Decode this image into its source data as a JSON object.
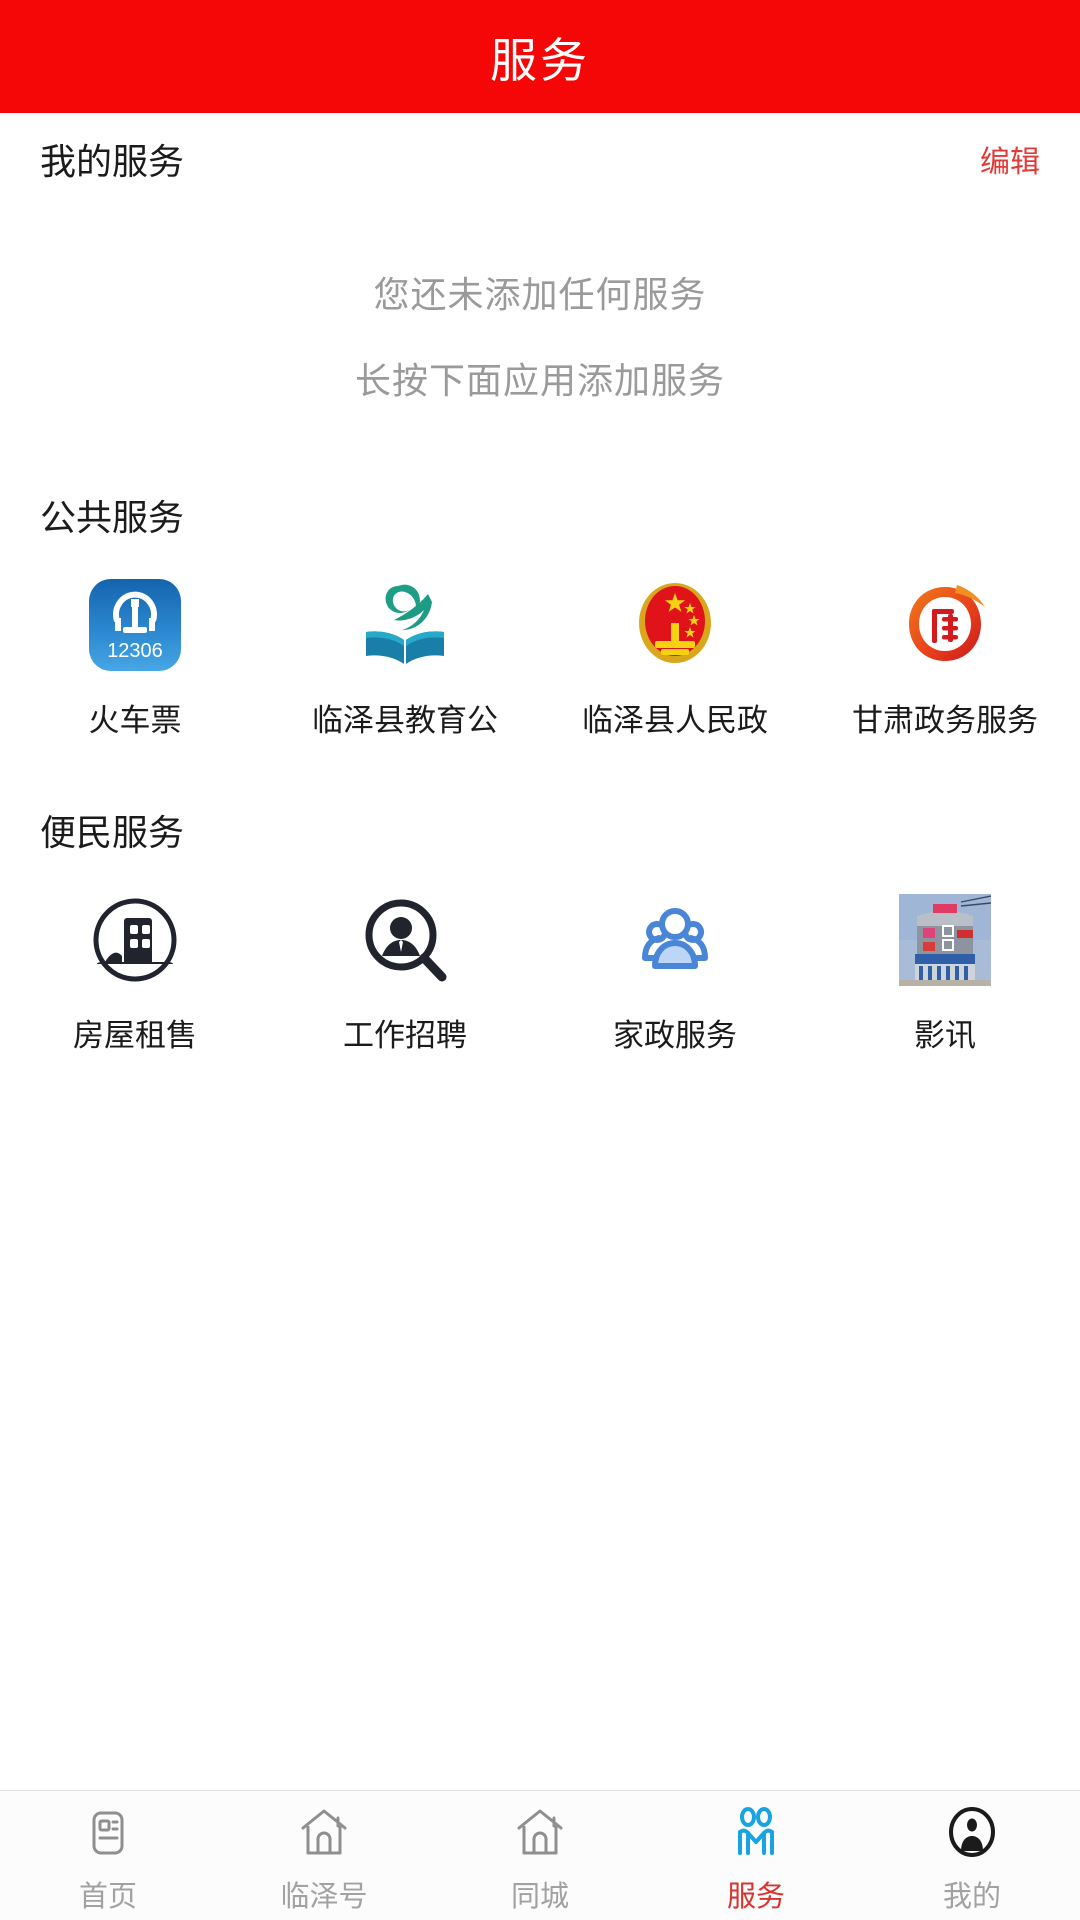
{
  "header": {
    "title": "服务",
    "bg_color": "#f50707"
  },
  "my_services": {
    "title": "我的服务",
    "edit_label": "编辑",
    "edit_color": "#e23a37",
    "empty_line_1": "您还未添加任何服务",
    "empty_line_2": "长按下面应用添加服务"
  },
  "sections": [
    {
      "title": "公共服务",
      "items": [
        {
          "label": "火车票",
          "icon": "railway-12306-icon",
          "badge_text": "12306"
        },
        {
          "label": "临泽县教育公",
          "icon": "education-book-icon"
        },
        {
          "label": "临泽县人民政",
          "icon": "national-emblem-icon"
        },
        {
          "label": "甘肃政务服务",
          "icon": "gansu-long-icon"
        }
      ]
    },
    {
      "title": "便民服务",
      "items": [
        {
          "label": "房屋租售",
          "icon": "building-circle-icon"
        },
        {
          "label": "工作招聘",
          "icon": "person-magnifier-icon"
        },
        {
          "label": "家政服务",
          "icon": "people-group-icon"
        },
        {
          "label": "影讯",
          "icon": "cinema-photo-icon"
        }
      ]
    }
  ],
  "bottom_nav": {
    "active_color": "#d9332f",
    "active_icon_color": "#19a3e1",
    "items": [
      {
        "label": "首页",
        "icon": "news-card-icon",
        "active": false
      },
      {
        "label": "临泽号",
        "icon": "house-icon",
        "active": false
      },
      {
        "label": "同城",
        "icon": "house-icon",
        "active": false
      },
      {
        "label": "服务",
        "icon": "two-people-icon",
        "active": true
      },
      {
        "label": "我的",
        "icon": "person-circle-icon",
        "active": false
      }
    ]
  }
}
